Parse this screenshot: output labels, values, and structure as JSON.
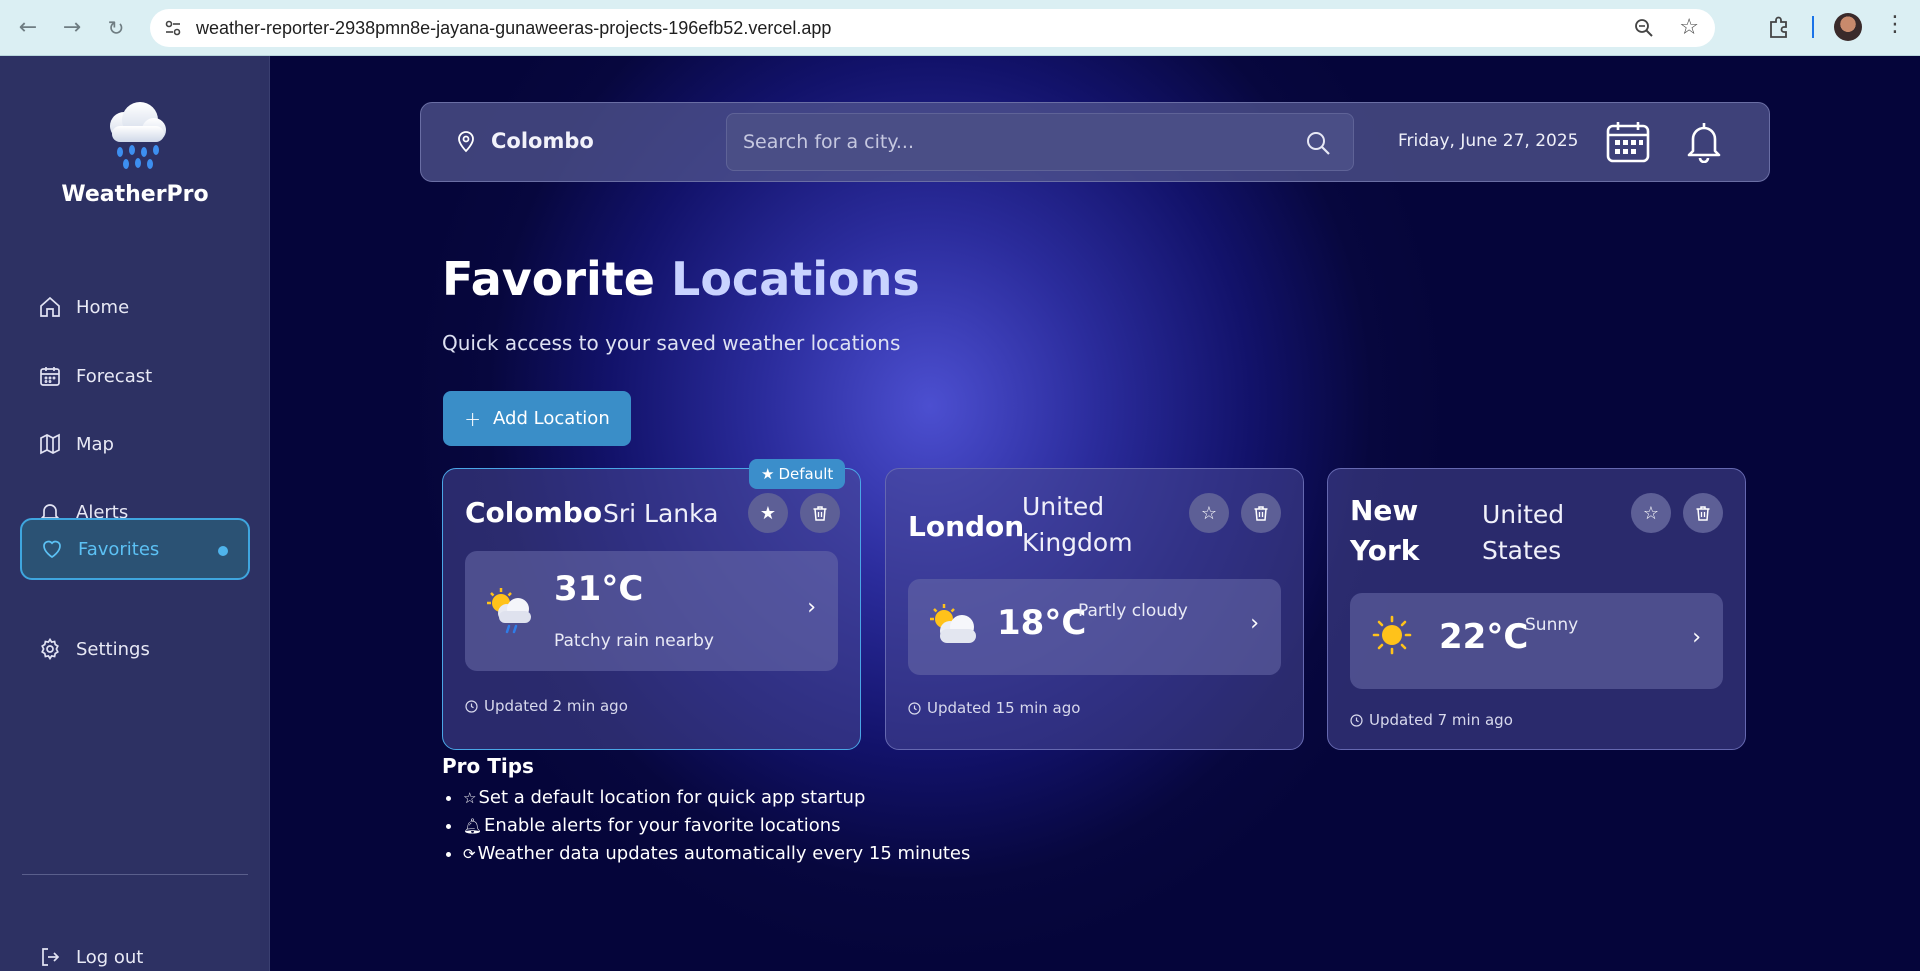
{
  "browser": {
    "url": "weather-reporter-2938pmn8e-jayana-gunaweeras-projects-196efb52.vercel.app"
  },
  "sidebar": {
    "brand": "WeatherPro",
    "items": [
      {
        "label": "Home"
      },
      {
        "label": "Forecast"
      },
      {
        "label": "Map"
      },
      {
        "label": "Alerts"
      },
      {
        "label": "Favorites"
      },
      {
        "label": "Settings"
      }
    ],
    "logout": "Log out"
  },
  "header": {
    "location": "Colombo",
    "search_placeholder": "Search for a city...",
    "date": "Friday, June 27, 2025"
  },
  "page": {
    "title_part1": "Favorite",
    "title_part2": "Locations",
    "subtitle": "Quick access to your saved weather locations",
    "add_button": "Add Location"
  },
  "cards": [
    {
      "city": "Colombo",
      "country": "Sri Lanka",
      "badge": "Default",
      "temp": "31°C",
      "condition": "Patchy rain nearby",
      "updated": "Updated 2 min ago",
      "icon": "rain-sun-cloud-icon"
    },
    {
      "city": "London",
      "country": "United Kingdom",
      "temp": "18°C",
      "condition": "Partly cloudy",
      "updated": "Updated 15 min ago",
      "icon": "partly-cloudy-icon"
    },
    {
      "city": "New York",
      "country": "United States",
      "temp": "22°C",
      "condition": "Sunny",
      "updated": "Updated 7 min ago",
      "icon": "sun-icon"
    }
  ],
  "tips": {
    "heading": "Pro Tips",
    "items": [
      "Set a default location for quick app startup",
      "Enable alerts for your favorite locations",
      "Weather data updates automatically every 15 minutes"
    ]
  },
  "colors": {
    "accent": "#3a8ec8",
    "sidebar": "#2d3163",
    "background": "#06063a"
  }
}
